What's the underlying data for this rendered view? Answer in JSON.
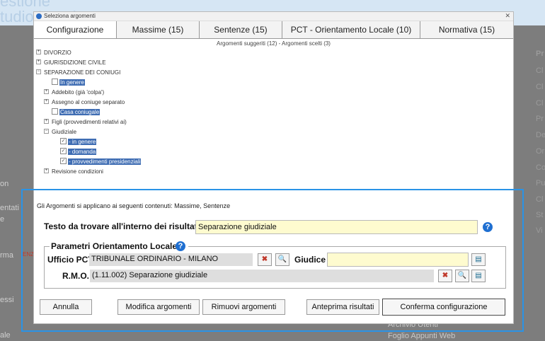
{
  "background": {
    "brand_lines": [
      "estione",
      "tudio Legale"
    ],
    "left_fragments": [
      "on",
      "entati",
      "e",
      "rma",
      "essi",
      "ale"
    ],
    "left_red": "ENZ",
    "right_header": "Pr",
    "right_items": [
      "Cl",
      "Cl",
      "Cl",
      "Pr",
      "De",
      "Or",
      "Co",
      "Pu",
      "Cl",
      "St",
      "Vi"
    ],
    "bottom_links": [
      "Archivio Utenti",
      "Foglio Appunti Web"
    ]
  },
  "dialog": {
    "title": "Seleziona argomenti",
    "close_glyph": "✕",
    "tabs": [
      {
        "label": "Configurazione"
      },
      {
        "label": "Massime (15)"
      },
      {
        "label": "Sentenze (15)"
      },
      {
        "label": "PCT - Orientamento Locale (10)"
      },
      {
        "label": "Normativa (15)"
      }
    ],
    "subheader": "Argomenti suggeriti (12)  -  Argomenti scelti (3)",
    "tree": [
      {
        "label": "DIVORZIO",
        "exp": "+"
      },
      {
        "label": "GIURISDIZIONE CIVILE",
        "exp": "+"
      },
      {
        "label": "SEPARAZIONE DEI CONIUGI",
        "exp": "−"
      },
      {
        "label": "In genere",
        "check": ""
      },
      {
        "label": "Addebito (già 'colpa')",
        "exp": "+"
      },
      {
        "label": "Assegno al coniuge separato",
        "exp": "+"
      },
      {
        "label": "Casa coniugale",
        "check": ""
      },
      {
        "label": "Figli (provvedimenti relativi ai)",
        "exp": "+"
      },
      {
        "label": "Giudiziale",
        "exp": "−"
      },
      {
        "label": "- in genere",
        "check": "✓"
      },
      {
        "label": "- domanda",
        "check": "✓"
      },
      {
        "label": "- provvedimenti presidenziali",
        "check": "✓"
      },
      {
        "label": "Revisione condizioni",
        "exp": "+"
      }
    ],
    "info_line": "Gli Argomenti si applicano ai seguenti contenuti: Massime, Sentenze",
    "search": {
      "label": "Testo da trovare all'interno dei risultati",
      "value": "Separazione giudiziale",
      "help": "?"
    },
    "local": {
      "legend": "Parametri Orientamento Locale",
      "help": "?",
      "ufficio_label": "Ufficio PCT",
      "ufficio_value": "TRIBUNALE ORDINARIO - MILANO",
      "giudice_label": "Giudice",
      "giudice_value": "",
      "rmo_label": "R.M.O.",
      "rmo_value": "(1.11.002) Separazione giudiziale",
      "remove_glyph": "✖",
      "search_glyph": "🔍",
      "pick_glyph": "▤"
    },
    "buttons": {
      "cancel": "Annulla",
      "modify": "Modifica argomenti",
      "remove": "Rimuovi argomenti",
      "preview": "Anteprima risultati",
      "confirm": "Conferma configurazione"
    }
  },
  "colors": {
    "highlight_border": "#2a93e6",
    "field_yellow": "#fefbcf",
    "help_blue": "#1f6fd1",
    "selection_blue": "#3f6db3"
  }
}
